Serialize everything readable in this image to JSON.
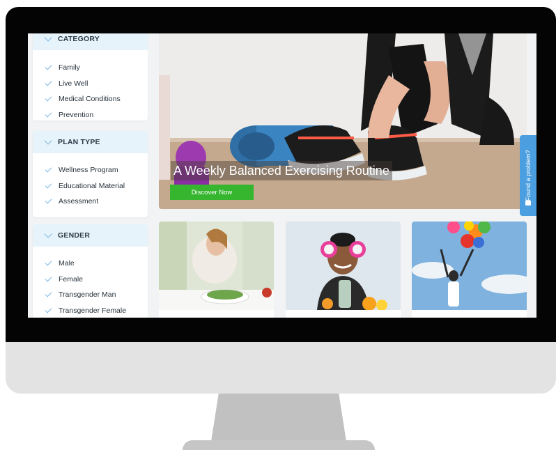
{
  "sidebar": {
    "sections": [
      {
        "title": "CATEGORY",
        "items": [
          "Family",
          "Live Well",
          "Medical Conditions",
          "Prevention"
        ]
      },
      {
        "title": "PLAN TYPE",
        "items": [
          "Wellness Program",
          "Educational Material",
          "Assessment"
        ]
      },
      {
        "title": "GENDER",
        "items": [
          "Male",
          "Female",
          "Transgender Man",
          "Transgender Female"
        ]
      }
    ]
  },
  "hero": {
    "title": "A Weekly Balanced Exercising Routine",
    "button_label": "Discover Now"
  },
  "feedback_tab": {
    "label": "Found a problem?"
  },
  "colors": {
    "accent_green": "#36b52f",
    "filter_header": "#e6f3fb",
    "check_blue": "#7ab6e3",
    "feedback_blue": "#4b9fe0",
    "bezel": "#040404",
    "chin": "#e3e3e3"
  },
  "icons": {
    "filter_header": "chevron-down-icon",
    "filter_item": "checkmark-icon",
    "feedback": "chat-icon"
  }
}
